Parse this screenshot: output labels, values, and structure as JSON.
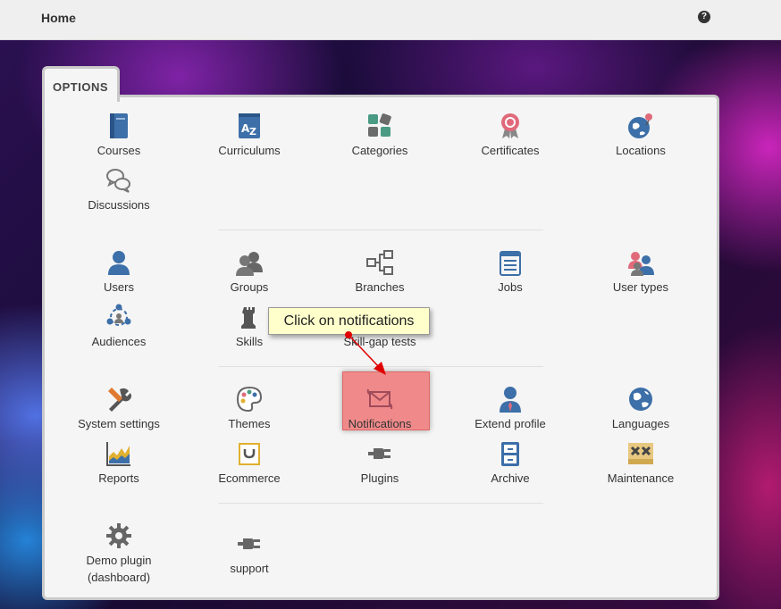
{
  "topbar": {
    "home_label": "Home",
    "help_icon": "question-circle-icon"
  },
  "options_tab_label": "OPTIONS",
  "items": {
    "courses": "Courses",
    "curriculums": "Curriculums",
    "categories": "Categories",
    "certificates": "Certificates",
    "locations": "Locations",
    "discussions": "Discussions",
    "users": "Users",
    "groups": "Groups",
    "branches": "Branches",
    "jobs": "Jobs",
    "user_types": "User types",
    "audiences": "Audiences",
    "skills": "Skills",
    "skill_gap_tests": "Skill-gap tests",
    "system_settings": "System settings",
    "themes": "Themes",
    "notifications": "Notifications",
    "extend_profile": "Extend profile",
    "languages": "Languages",
    "reports": "Reports",
    "ecommerce": "Ecommerce",
    "plugins": "Plugins",
    "archive": "Archive",
    "maintenance": "Maintenance",
    "demo_plugin": "Demo plugin (dashboard)",
    "support": "support"
  },
  "callout_text": "Click on notifications",
  "colors": {
    "highlight": "#f08a8a",
    "callout_bg": "#ffffcc",
    "arrow": "#e00000"
  }
}
